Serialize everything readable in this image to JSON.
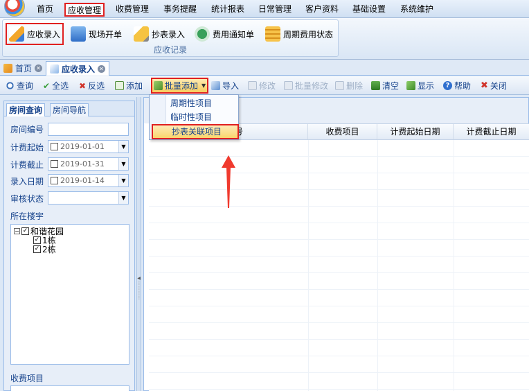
{
  "menu": {
    "items": [
      "首页",
      "应收管理",
      "收费管理",
      "事务提醒",
      "统计报表",
      "日常管理",
      "客户资料",
      "基础设置",
      "系统维护"
    ],
    "active_index": 1
  },
  "ribbon": {
    "buttons": [
      {
        "label": "应收录入",
        "icon": "pencil-icon"
      },
      {
        "label": "现场开单",
        "icon": "clipboard-icon"
      },
      {
        "label": "抄表录入",
        "icon": "pen-icon"
      },
      {
        "label": "费用通知单",
        "icon": "notice-arrow-icon"
      },
      {
        "label": "周期费用状态",
        "icon": "list-icon"
      }
    ],
    "group_label": "应收记录"
  },
  "tabs": [
    {
      "label": "首页",
      "icon": "home-icon"
    },
    {
      "label": "应收录入",
      "icon": "document-icon"
    }
  ],
  "toolbar": {
    "query": "查询",
    "select_all": "全选",
    "invert": "反选",
    "add": "添加",
    "batch_add": "批量添加",
    "import": "导入",
    "edit": "修改",
    "batch_edit": "批量修改",
    "delete": "删除",
    "clear": "清空",
    "show": "显示",
    "help": "帮助",
    "close": "关闭"
  },
  "dropdown": {
    "items": [
      "周期性项目",
      "临时性项目",
      "抄表关联项目"
    ],
    "selected_index": 2
  },
  "left_panel": {
    "tabs": [
      "房间查询",
      "房间导航"
    ],
    "room_no_label": "房间编号",
    "start_label": "计费起始",
    "start_value": "2019-01-01",
    "end_label": "计费截止",
    "end_value": "2019-01-31",
    "entry_label": "录入日期",
    "entry_value": "2019-01-14",
    "audit_label": "审核状态",
    "building_label": "所在楼宇",
    "tree": {
      "root": "和谐花园",
      "children": [
        "1栋",
        "2栋"
      ]
    },
    "fee_item_label": "收费项目"
  },
  "grid": {
    "columns": [
      "号",
      "收费项目",
      "计费起始日期",
      "计费截止日期"
    ]
  },
  "colors": {
    "highlight": "#e02020",
    "panel_bg": "#dce8f6",
    "text": "#15428b"
  }
}
